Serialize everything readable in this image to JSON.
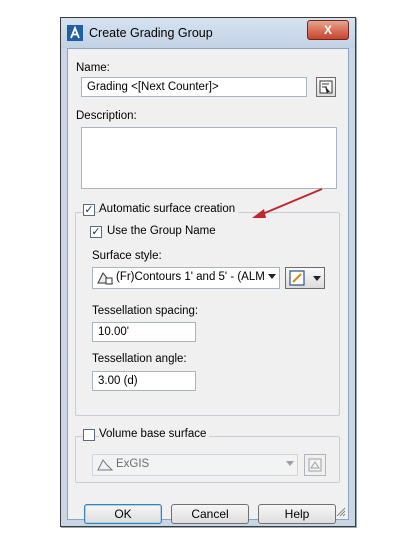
{
  "window": {
    "title": "Create Grading Group",
    "close_label": "X"
  },
  "name": {
    "label": "Name:",
    "value": "Grading <[Next Counter]>"
  },
  "description": {
    "label": "Description:",
    "value": ""
  },
  "auto_surface": {
    "label": "Automatic surface creation",
    "checked": true,
    "use_group_name": {
      "label": "Use the Group Name",
      "checked": true
    },
    "surface_style": {
      "label": "Surface style:",
      "value": "(Fr)Contours 1' and 5' - (ALM"
    },
    "tessellation_spacing": {
      "label": "Tessellation spacing:",
      "value": "10.00'"
    },
    "tessellation_angle": {
      "label": "Tessellation angle:",
      "value": "3.00 (d)"
    }
  },
  "volume_base": {
    "label": "Volume base surface",
    "checked": false,
    "value": "ExGIS"
  },
  "buttons": {
    "ok": "OK",
    "cancel": "Cancel",
    "help": "Help"
  },
  "annotation": {
    "arrow_color": "#c0272d"
  }
}
